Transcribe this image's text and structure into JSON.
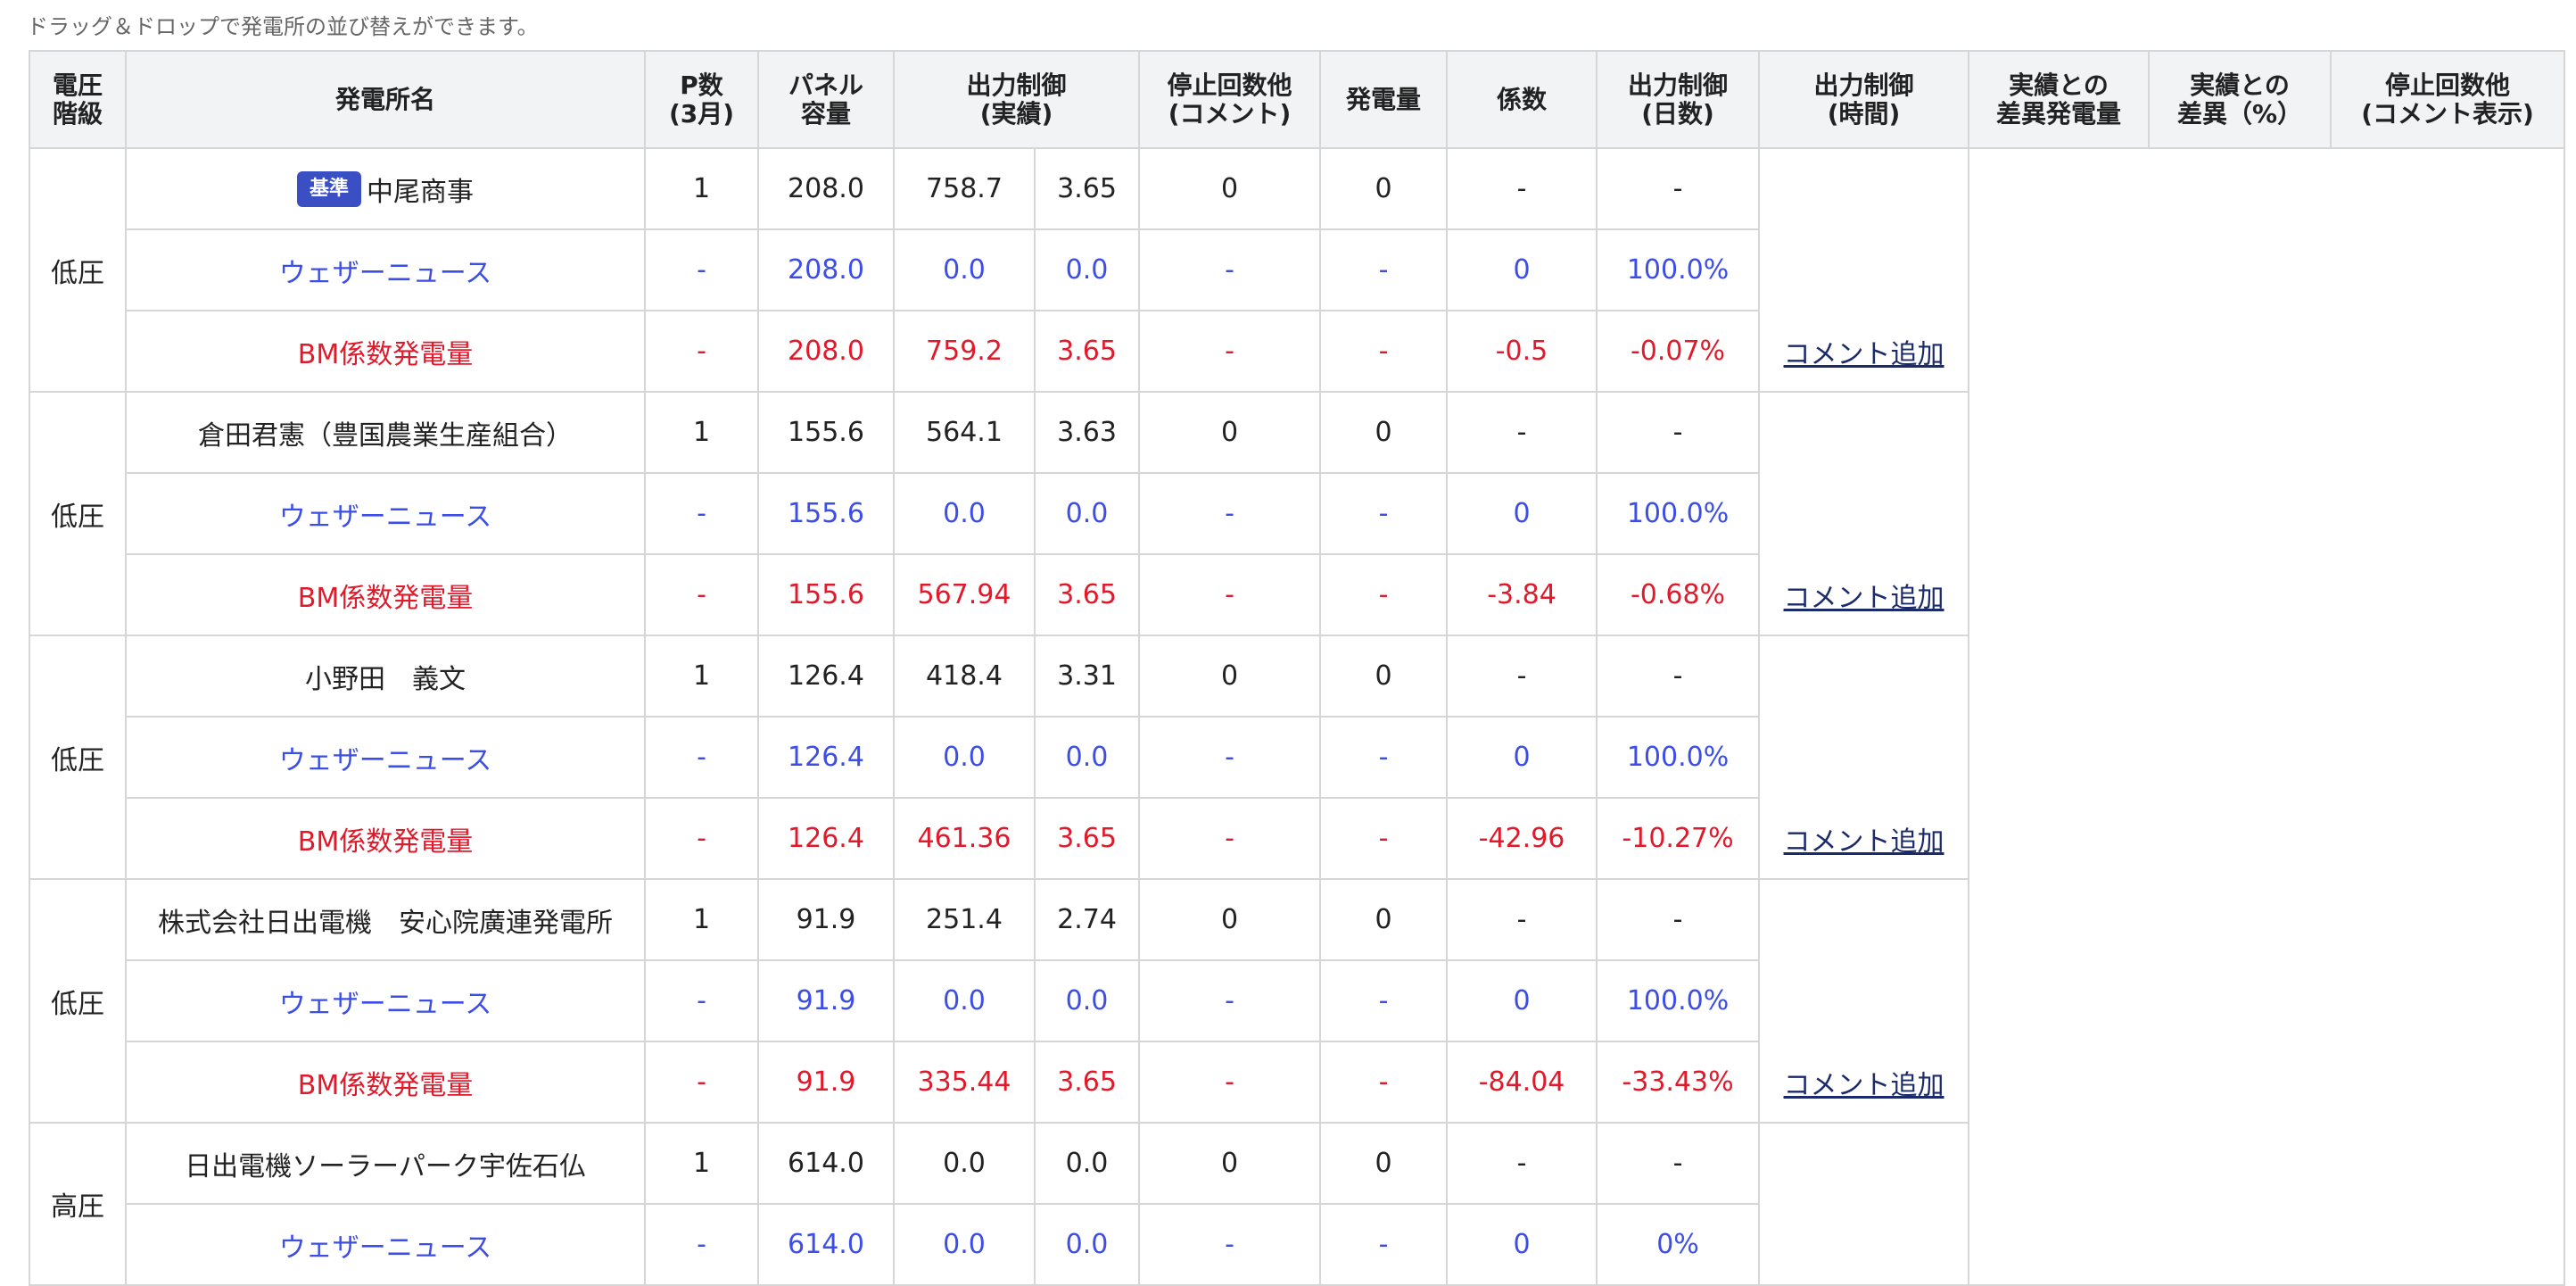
{
  "hint": "ドラッグ＆ドロップで発電所の並び替えができます。",
  "headers": {
    "voltage": "電圧\n階級",
    "name": "発電所名",
    "p_count": "P数\n(3月)",
    "panel": "パネル\n容量",
    "output_actual": "出力制御\n(実績)",
    "stop_comment": "停止回数他\n(コメント)",
    "generation": "発電量",
    "coef": "係数",
    "output_days": "出力制御\n(日数)",
    "output_time": "出力制御\n(時間)",
    "diff_gen": "実績との\n差異発電量",
    "diff_pct": "実績との\n差異（%）",
    "stop_display": "停止回数他\n(コメント表示)"
  },
  "badge_label": "基準",
  "comment_link_label": "コメント追加",
  "colors": {
    "blue": "#3d4ee6",
    "red": "#e01a2b",
    "badge": "#3a4fc4",
    "header_bg": "#f2f3f5"
  },
  "groups": [
    {
      "voltage": "低圧",
      "rows": [
        {
          "type": "plant",
          "name": "中尾商事",
          "badge": true,
          "p": "1",
          "panel": "208.0",
          "out1": "758.7",
          "out2": "3.65",
          "stop": "0",
          "gen": "0",
          "coef": "-",
          "days": "-"
        },
        {
          "type": "weather",
          "name": "ウェザーニュース",
          "p": "-",
          "panel": "208.0",
          "out1": "0.0",
          "out2": "0.0",
          "stop": "-",
          "gen": "-",
          "coef": "0",
          "days": "100.0%"
        },
        {
          "type": "bm",
          "name": "BM係数発電量",
          "p": "-",
          "panel": "208.0",
          "out1": "759.2",
          "out2": "3.65",
          "stop": "-",
          "gen": "-",
          "coef": "-0.5",
          "days": "-0.07%"
        }
      ]
    },
    {
      "voltage": "低圧",
      "rows": [
        {
          "type": "plant",
          "name": "倉田君憲（豊国農業生産組合）",
          "badge": false,
          "p": "1",
          "panel": "155.6",
          "out1": "564.1",
          "out2": "3.63",
          "stop": "0",
          "gen": "0",
          "coef": "-",
          "days": "-"
        },
        {
          "type": "weather",
          "name": "ウェザーニュース",
          "p": "-",
          "panel": "155.6",
          "out1": "0.0",
          "out2": "0.0",
          "stop": "-",
          "gen": "-",
          "coef": "0",
          "days": "100.0%"
        },
        {
          "type": "bm",
          "name": "BM係数発電量",
          "p": "-",
          "panel": "155.6",
          "out1": "567.94",
          "out2": "3.65",
          "stop": "-",
          "gen": "-",
          "coef": "-3.84",
          "days": "-0.68%"
        }
      ]
    },
    {
      "voltage": "低圧",
      "rows": [
        {
          "type": "plant",
          "name": "小野田　義文",
          "badge": false,
          "p": "1",
          "panel": "126.4",
          "out1": "418.4",
          "out2": "3.31",
          "stop": "0",
          "gen": "0",
          "coef": "-",
          "days": "-"
        },
        {
          "type": "weather",
          "name": "ウェザーニュース",
          "p": "-",
          "panel": "126.4",
          "out1": "0.0",
          "out2": "0.0",
          "stop": "-",
          "gen": "-",
          "coef": "0",
          "days": "100.0%"
        },
        {
          "type": "bm",
          "name": "BM係数発電量",
          "p": "-",
          "panel": "126.4",
          "out1": "461.36",
          "out2": "3.65",
          "stop": "-",
          "gen": "-",
          "coef": "-42.96",
          "days": "-10.27%"
        }
      ]
    },
    {
      "voltage": "低圧",
      "rows": [
        {
          "type": "plant",
          "name": "株式会社日出電機　安心院廣連発電所",
          "badge": false,
          "p": "1",
          "panel": "91.9",
          "out1": "251.4",
          "out2": "2.74",
          "stop": "0",
          "gen": "0",
          "coef": "-",
          "days": "-"
        },
        {
          "type": "weather",
          "name": "ウェザーニュース",
          "p": "-",
          "panel": "91.9",
          "out1": "0.0",
          "out2": "0.0",
          "stop": "-",
          "gen": "-",
          "coef": "0",
          "days": "100.0%"
        },
        {
          "type": "bm",
          "name": "BM係数発電量",
          "p": "-",
          "panel": "91.9",
          "out1": "335.44",
          "out2": "3.65",
          "stop": "-",
          "gen": "-",
          "coef": "-84.04",
          "days": "-33.43%"
        }
      ]
    },
    {
      "voltage": "高圧",
      "rows": [
        {
          "type": "plant",
          "name": "日出電機ソーラーパーク宇佐石仏",
          "badge": false,
          "p": "1",
          "panel": "614.0",
          "out1": "0.0",
          "out2": "0.0",
          "stop": "0",
          "gen": "0",
          "coef": "-",
          "days": "-"
        },
        {
          "type": "weather",
          "name": "ウェザーニュース",
          "p": "-",
          "panel": "614.0",
          "out1": "0.0",
          "out2": "0.0",
          "stop": "-",
          "gen": "-",
          "coef": "0",
          "days": "0%"
        }
      ]
    }
  ]
}
